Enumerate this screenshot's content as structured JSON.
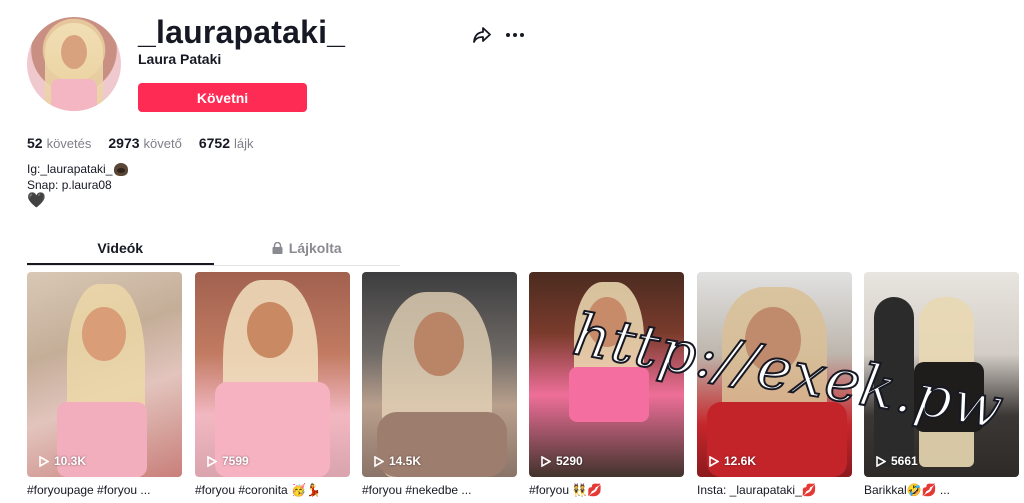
{
  "profile": {
    "username": "_laurapataki_",
    "nickname": "Laura Pataki",
    "follow_label": "Követni"
  },
  "stats": [
    {
      "value": "52",
      "label": "követés"
    },
    {
      "value": "2973",
      "label": "követő"
    },
    {
      "value": "6752",
      "label": "lájk"
    }
  ],
  "bio": {
    "line1": "Ig:_laurapataki_",
    "line2": "Snap: p.laura08",
    "line3": "🖤"
  },
  "tabs": [
    {
      "label": "Videók",
      "active": true
    },
    {
      "label": "Lájkolta",
      "active": false,
      "icon": "lock-icon"
    }
  ],
  "videos": [
    {
      "views": "10.3K",
      "caption": "#foryoupage #foryou ..."
    },
    {
      "views": "7599",
      "caption": "#foryou #coronita 🥳💃"
    },
    {
      "views": "14.5K",
      "caption": "#foryou #nekedbe ..."
    },
    {
      "views": "5290",
      "caption": "#foryou 👯💋"
    },
    {
      "views": "12.6K",
      "caption": "Insta: _laurapataki_💋"
    },
    {
      "views": "5661",
      "caption": "Barikkal🤣💋 ..."
    }
  ],
  "watermark": "http://exek.pw",
  "colors": {
    "accent": "#fe2c55",
    "text": "#161823",
    "muted": "#8a8b91"
  }
}
